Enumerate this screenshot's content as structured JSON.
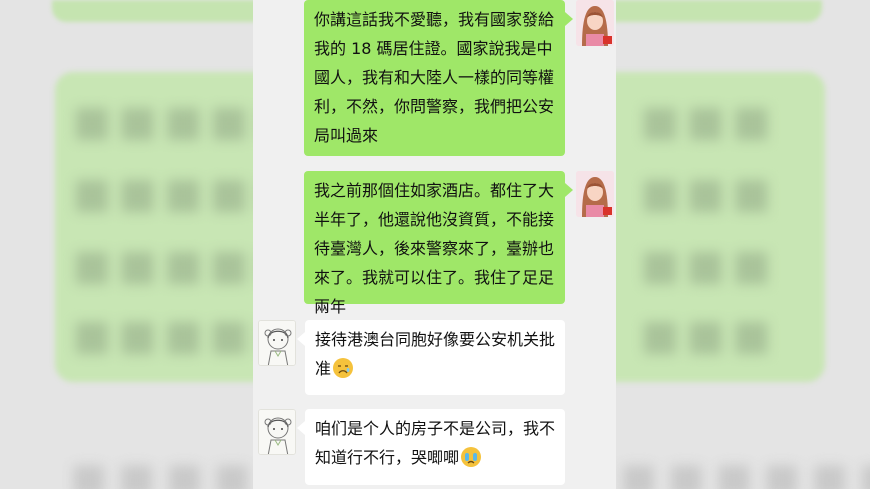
{
  "messages": [
    {
      "side": "sent",
      "text": "你講這話我不愛聽，我有國家發給我的 18 碼居住證。國家說我是中國人，我有和大陸人一樣的同等權利，不然，你問警察，我們把公安局叫過來"
    },
    {
      "side": "sent",
      "text": "我之前那個住如家酒店。都住了大半年了，他還說他沒資質，不能接待臺灣人，後來警察來了，臺辦也來了。我就可以住了。我住了足足兩年"
    },
    {
      "side": "received",
      "text": "接待港澳台同胞好像要公安机关批准",
      "emoji": "sad-face-emoji"
    },
    {
      "side": "received",
      "text": "咱们是个人的房子不是公司，我不知道行不行，哭唧唧",
      "emoji": "crying-face-emoji"
    }
  ],
  "colors": {
    "sent_bubble": "#9fe768",
    "received_bubble": "#ffffff",
    "chat_background": "#f0f0f0"
  }
}
